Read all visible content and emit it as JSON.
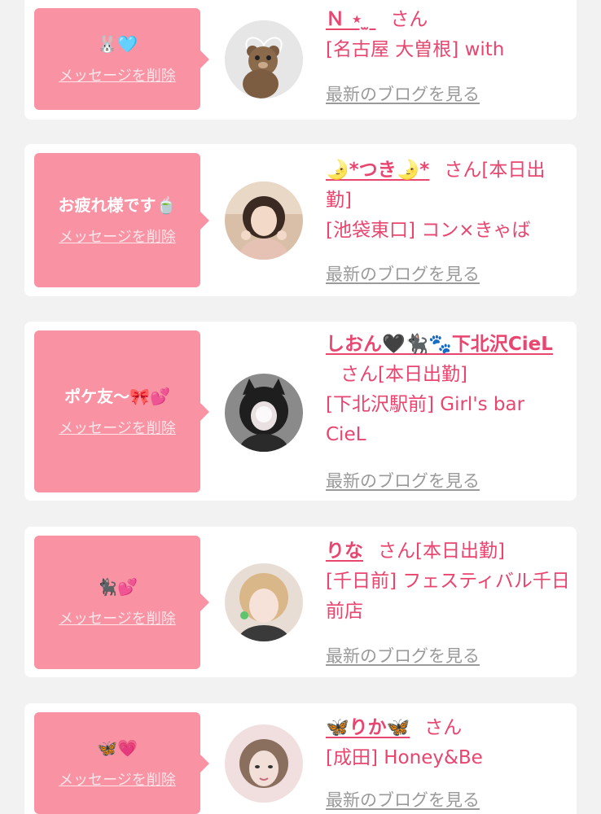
{
  "blog_link_label": "最新のブログを見る",
  "delete_label": "メッセージを削除",
  "honorific": "さん",
  "cards": [
    {
      "message": "🐰🩵",
      "name": "Ｎ ⋆ ̫ ",
      "status": "",
      "shop": "[名古屋 大曽根] with"
    },
    {
      "message": "お疲れ様です🍵",
      "name": "🌛*つき🌛*",
      "status": "[本日出勤]",
      "shop": "[池袋東口] コン×きゃば"
    },
    {
      "message": "ポケ友〜🎀💕",
      "name": "しおん🖤🐈‍⬛🐾下北沢CieL",
      "status": "[本日出勤]",
      "shop": "[下北沢駅前] Girl's bar CieL"
    },
    {
      "message": "🐈‍⬛💕",
      "name": "りな",
      "status": "[本日出勤]",
      "shop": "[千日前] フェスティバル千日前店"
    },
    {
      "message": "🦋💗",
      "name": "🦋りか🦋",
      "status": "",
      "shop": "[成田] Honey&Be"
    }
  ],
  "colors": {
    "bubble": "#f992a3",
    "accent": "#e8456f",
    "link_gray": "#9a9a9a",
    "background": "#f2f2f2"
  }
}
